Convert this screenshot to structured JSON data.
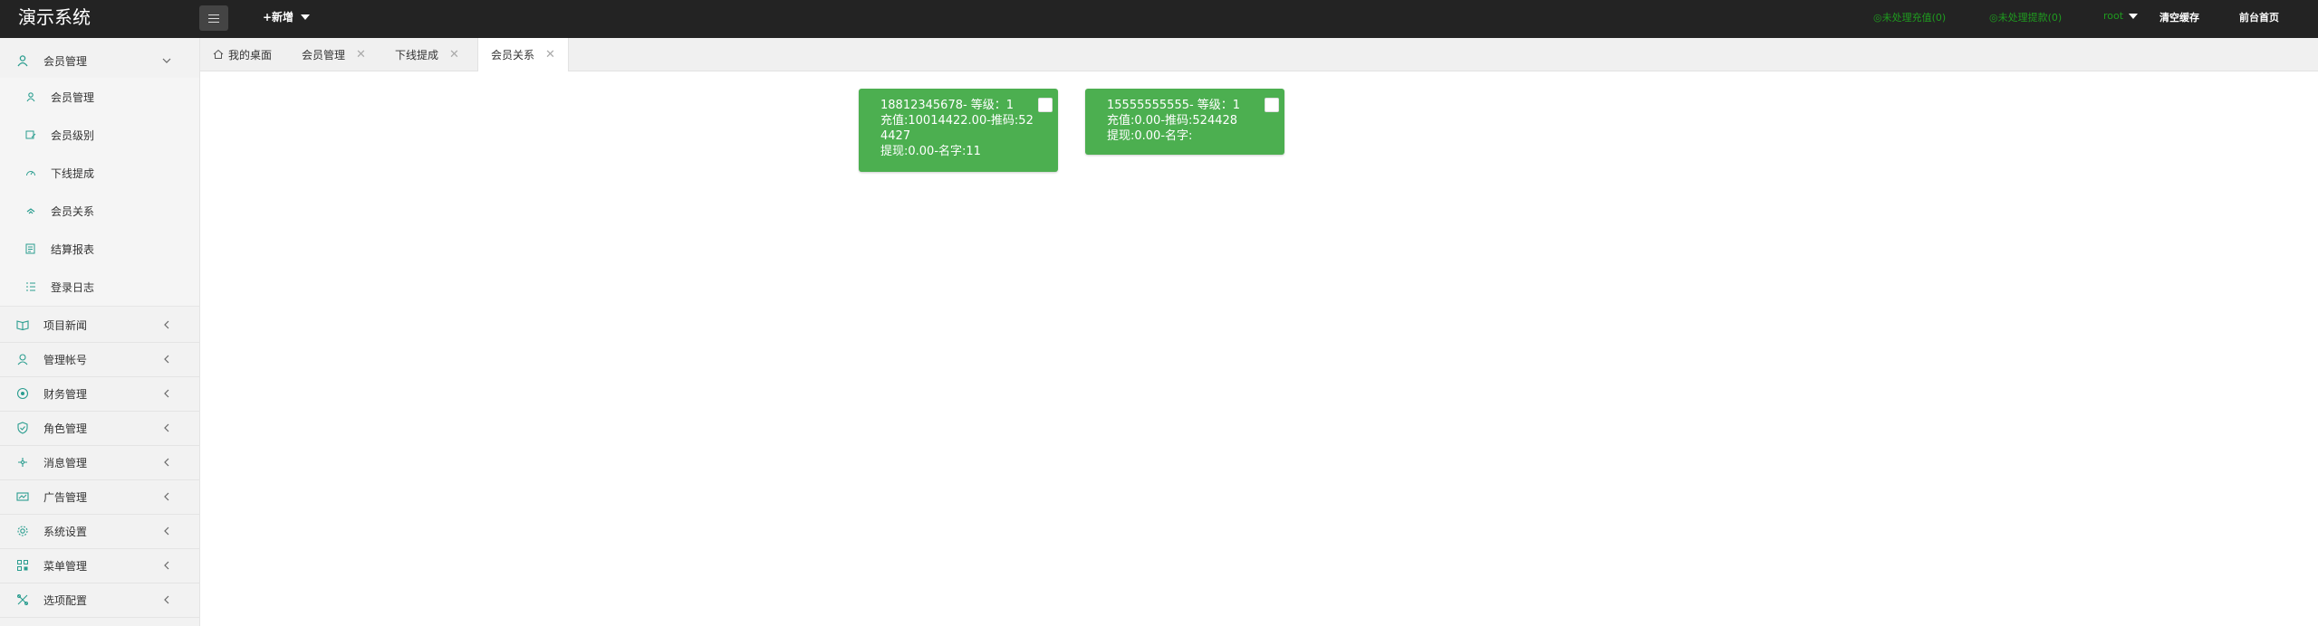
{
  "app": {
    "title": "演示系统"
  },
  "header": {
    "add_label": "+新增",
    "pending_recharge": "未处理充值(0)",
    "pending_withdraw": "未处理提款(0)",
    "user": "root",
    "clear_cache": "清空缓存",
    "front_home": "前台首页"
  },
  "sidebar": {
    "groups": [
      {
        "label": "会员管理",
        "icon": "user-icon"
      },
      {
        "label": "项目新闻",
        "icon": "news-icon"
      },
      {
        "label": "管理帐号",
        "icon": "account-icon"
      },
      {
        "label": "财务管理",
        "icon": "finance-icon"
      },
      {
        "label": "角色管理",
        "icon": "shield-icon"
      },
      {
        "label": "消息管理",
        "icon": "message-icon"
      },
      {
        "label": "广告管理",
        "icon": "ad-icon"
      },
      {
        "label": "系统设置",
        "icon": "gear-icon"
      },
      {
        "label": "菜单管理",
        "icon": "menu-icon"
      },
      {
        "label": "选项配置",
        "icon": "config-icon"
      }
    ],
    "sub_items": [
      {
        "label": "会员管理",
        "icon": "user-icon"
      },
      {
        "label": "会员级别",
        "icon": "level-icon"
      },
      {
        "label": "下线提成",
        "icon": "gauge-icon"
      },
      {
        "label": "会员关系",
        "icon": "relation-icon"
      },
      {
        "label": "结算报表",
        "icon": "report-icon"
      },
      {
        "label": "登录日志",
        "icon": "log-icon"
      }
    ]
  },
  "tabs": [
    {
      "label": "我的桌面",
      "icon": "home-icon"
    },
    {
      "label": "会员管理"
    },
    {
      "label": "下线提成"
    },
    {
      "label": "会员关系"
    }
  ],
  "cards": [
    {
      "line1": "18812345678- 等级：1",
      "line2": "充值:10014422.00-推码:524427",
      "line3": "提现:0.00-名字:11"
    },
    {
      "line1": "15555555555- 等级：1",
      "line2": "充值:0.00-推码:524428",
      "line3": "提现:0.00-名字:"
    }
  ],
  "colors": {
    "header_bg": "#232323",
    "accent_green": "#4caf50",
    "sidebar_bg": "#f2f2f2"
  }
}
